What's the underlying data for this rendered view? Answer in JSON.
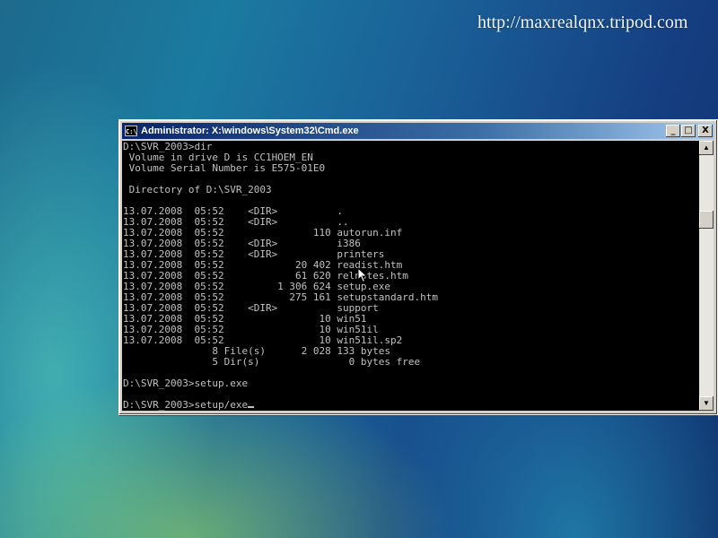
{
  "watermark": "http://maxrealqnx.tripod.com",
  "window": {
    "title": "Administrator: X:\\windows\\System32\\Cmd.exe",
    "icon_label": "C:\\",
    "buttons": {
      "minimize": "_",
      "maximize": "□",
      "close": "X"
    }
  },
  "console": {
    "lines": [
      "D:\\SVR_2003>dir",
      " Volume in drive D is CC1HOEM_EN",
      " Volume Serial Number is E575-01E0",
      "",
      " Directory of D:\\SVR_2003",
      "",
      "13.07.2008  05:52    <DIR>          .",
      "13.07.2008  05:52    <DIR>          ..",
      "13.07.2008  05:52               110 autorun.inf",
      "13.07.2008  05:52    <DIR>          i386",
      "13.07.2008  05:52    <DIR>          printers",
      "13.07.2008  05:52            20 402 readist.htm",
      "13.07.2008  05:52            61 620 relnotes.htm",
      "13.07.2008  05:52         1 306 624 setup.exe",
      "13.07.2008  05:52           275 161 setupstandard.htm",
      "13.07.2008  05:52    <DIR>          support",
      "13.07.2008  05:52                10 win51",
      "13.07.2008  05:52                10 win51il",
      "13.07.2008  05:52                10 win51il.sp2",
      "               8 File(s)      2 028 133 bytes",
      "               5 Dir(s)               0 bytes free",
      "",
      "D:\\SVR_2003>setup.exe",
      "",
      "D:\\SVR_2003>setup/exe"
    ]
  },
  "scrollbar": {
    "up_arrow": "▲",
    "down_arrow": "▼"
  }
}
